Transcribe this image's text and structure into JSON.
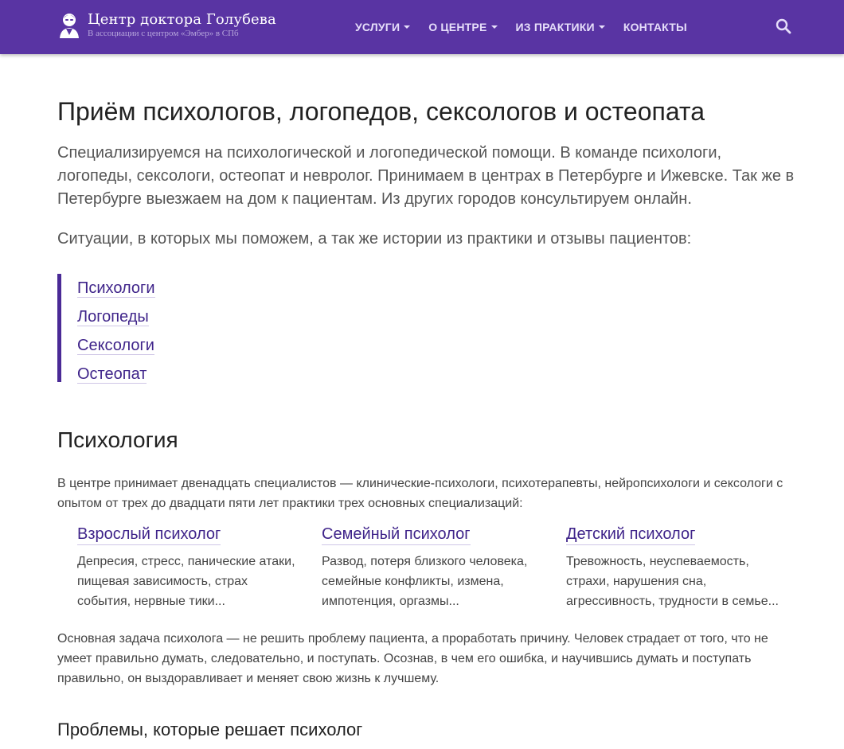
{
  "header": {
    "site_title": "Центр доктора Голубева",
    "site_subtitle": "В ассоциации с центром «Эмбер» в СПб",
    "nav": [
      {
        "label": "УСЛУГИ",
        "has_dropdown": true
      },
      {
        "label": "О ЦЕНТРЕ",
        "has_dropdown": true
      },
      {
        "label": "ИЗ ПРАКТИКИ",
        "has_dropdown": true
      },
      {
        "label": "КОНТАКТЫ",
        "has_dropdown": false
      }
    ],
    "search_icon": "search-icon",
    "logo_icon": "doctor-portrait-icon"
  },
  "main": {
    "title": "Приём психологов, логопедов, сексологов и остеопата",
    "lead": "Специализируемся на психологической и логопедической помощи. В команде психологи, логопеды, сексологи, остеопат и невролог. Принимаем в центрах в Петербурге и Ижевске. Так же в Петербурге выезжаем на дом к пациентам. Из других городов консультируем онлайн.",
    "lead2": "Ситуации, в которых мы поможем, а так же истории из практики и отзывы пациентов:",
    "quick_links": [
      "Психологи",
      "Логопеды",
      "Сексологи",
      "Остеопат"
    ]
  },
  "psychology": {
    "heading": "Психология",
    "intro": "В центре принимает двенадцать специалистов — клинические-психологи, психотерапевты, нейропсихологи и сексологи с опытом от трех до двадцати пяти лет практики трех основных специализаций:",
    "columns": [
      {
        "title": "Взрослый психолог",
        "text": "Депресия, стресс, панические атаки, пищевая зависимость, страх события, нервные тики..."
      },
      {
        "title": "Семейный психолог",
        "text": "Развод, потеря близкого человека, семейные конфликты, измена, импотенция, оргазмы..."
      },
      {
        "title": "Детский психолог",
        "text": "Тревожность, неуспеваемость, страхи, нарушения сна, агрессивность, трудности в семье..."
      }
    ],
    "main_task": "Основная задача психолога — не решить проблему пациента, а проработать причину. Человек страдает от того, что не умеет правильно думать, следовательно, и поступать. Осознав, в чем его ошибка, и научившись думать и поступать правильно, он выздоравливает и меняет свою жизнь к лучшему.",
    "subheading": "Проблемы, которые решает психолог"
  },
  "colors": {
    "header_bg": "#5934a3",
    "link": "#3f248a",
    "accent_border": "#4a2a96"
  }
}
